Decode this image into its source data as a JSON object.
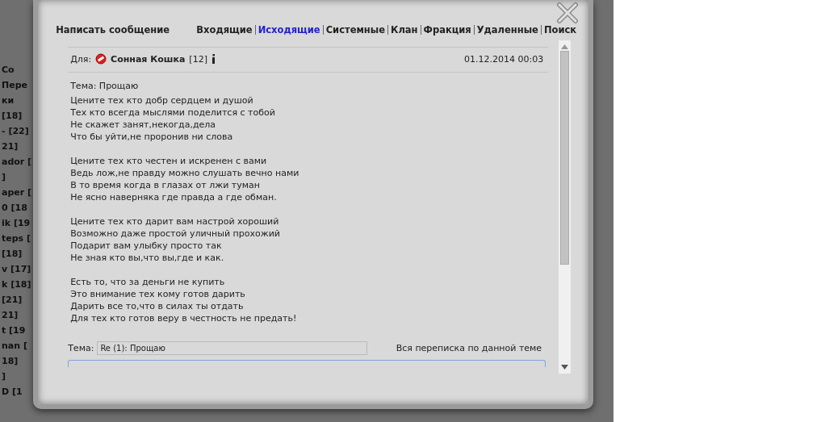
{
  "background_list": [
    "Co",
    "Пере",
    "ки",
    "[18]",
    "- [22]",
    "21]",
    "ador [",
    "]",
    "aper [",
    "0 [18",
    "ik [19",
    "teps [",
    "[18]",
    "v [17]",
    "k [18]",
    "[21]",
    "21]",
    "t [19",
    "nan [",
    "18]",
    "]",
    "D [1"
  ],
  "compose_link": "Написать сообщение",
  "folders": [
    {
      "label": "Входящие",
      "selected": false
    },
    {
      "label": "Исходящие",
      "selected": true
    },
    {
      "label": "Системные",
      "selected": false
    },
    {
      "label": "Клан",
      "selected": false
    },
    {
      "label": "Фракция",
      "selected": false
    },
    {
      "label": "Удаленные",
      "selected": false
    },
    {
      "label": "Поиск",
      "selected": false
    }
  ],
  "message": {
    "to_label": "Для:",
    "recipient": "Сонная Кошка",
    "recipient_rank": "[12]",
    "date": "01.12.2014 00:03",
    "subject": "Тема: Прощаю",
    "stanzas": [
      [
        "Цените тех кто добр сердцем и душой",
        "Тех кто всегда мыслями поделится с тобой",
        "Не скажет занят,некогда,дела",
        "Что бы уйти,не проронив ни слова"
      ],
      [
        "Цените тех кто честен и искренен с вами",
        "Ведь лож,не правду можно слушать вечно нами",
        "В то время когда в глазах от лжи туман",
        "Не ясно наверняка где правда а где обман."
      ],
      [
        "Цените тех кто дарит вам настрой хороший",
        "Возможно даже простой уличный прохожий",
        "Подарит вам улыбку просто так",
        "Не зная кто вы,что вы,где и как."
      ],
      [
        "Есть то, что за деньги не купить",
        "Это внимание тех кому готов дарить",
        "Дарить все то,что в силах ты отдать",
        "Для тех кто готов веру в честность не предать!"
      ]
    ]
  },
  "reply": {
    "subject_label": "Тема:",
    "subject_value": "Re (1): Прощаю",
    "thread_link": "Вся переписка по данной теме"
  }
}
